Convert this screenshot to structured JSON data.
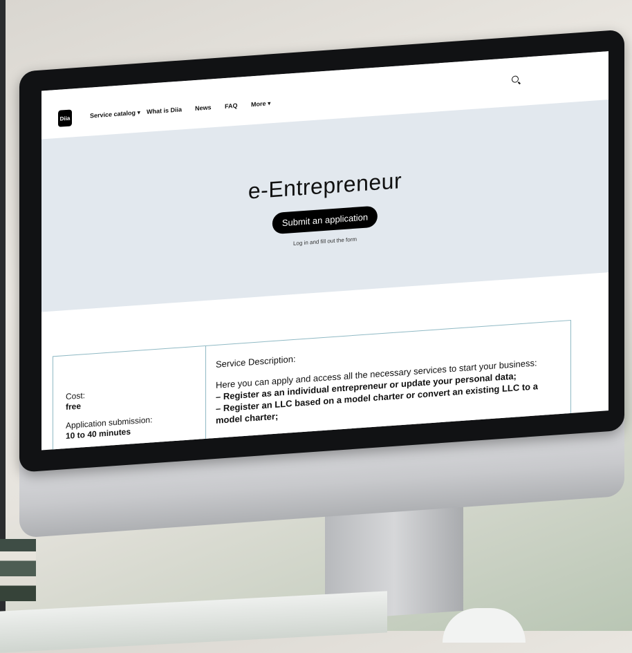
{
  "nav": {
    "logo": "Diia",
    "items": [
      "Service catalog ▾",
      "What is Diia",
      "News",
      "FAQ",
      "More ▾"
    ]
  },
  "hero": {
    "title": "e-Entrepreneur",
    "button": "Submit an application",
    "note": "Log in and fill out the form"
  },
  "info": {
    "cost_label": "Cost:",
    "cost_value": "free",
    "time_label": "Application submission:",
    "time_value": "10 to 40 minutes"
  },
  "description": {
    "title": "Service Description:",
    "lines": [
      "Here you can apply and access all the necessary services to start your business:",
      "– Register as an individual entrepreneur or update your personal data;",
      "– Register an LLC based on a model charter or convert an existing LLC to a",
      "model charter;"
    ]
  },
  "colors": {
    "hero_bg": "#e2e8ee",
    "button_bg": "#000000",
    "panel_border": "#8fb9c4"
  }
}
